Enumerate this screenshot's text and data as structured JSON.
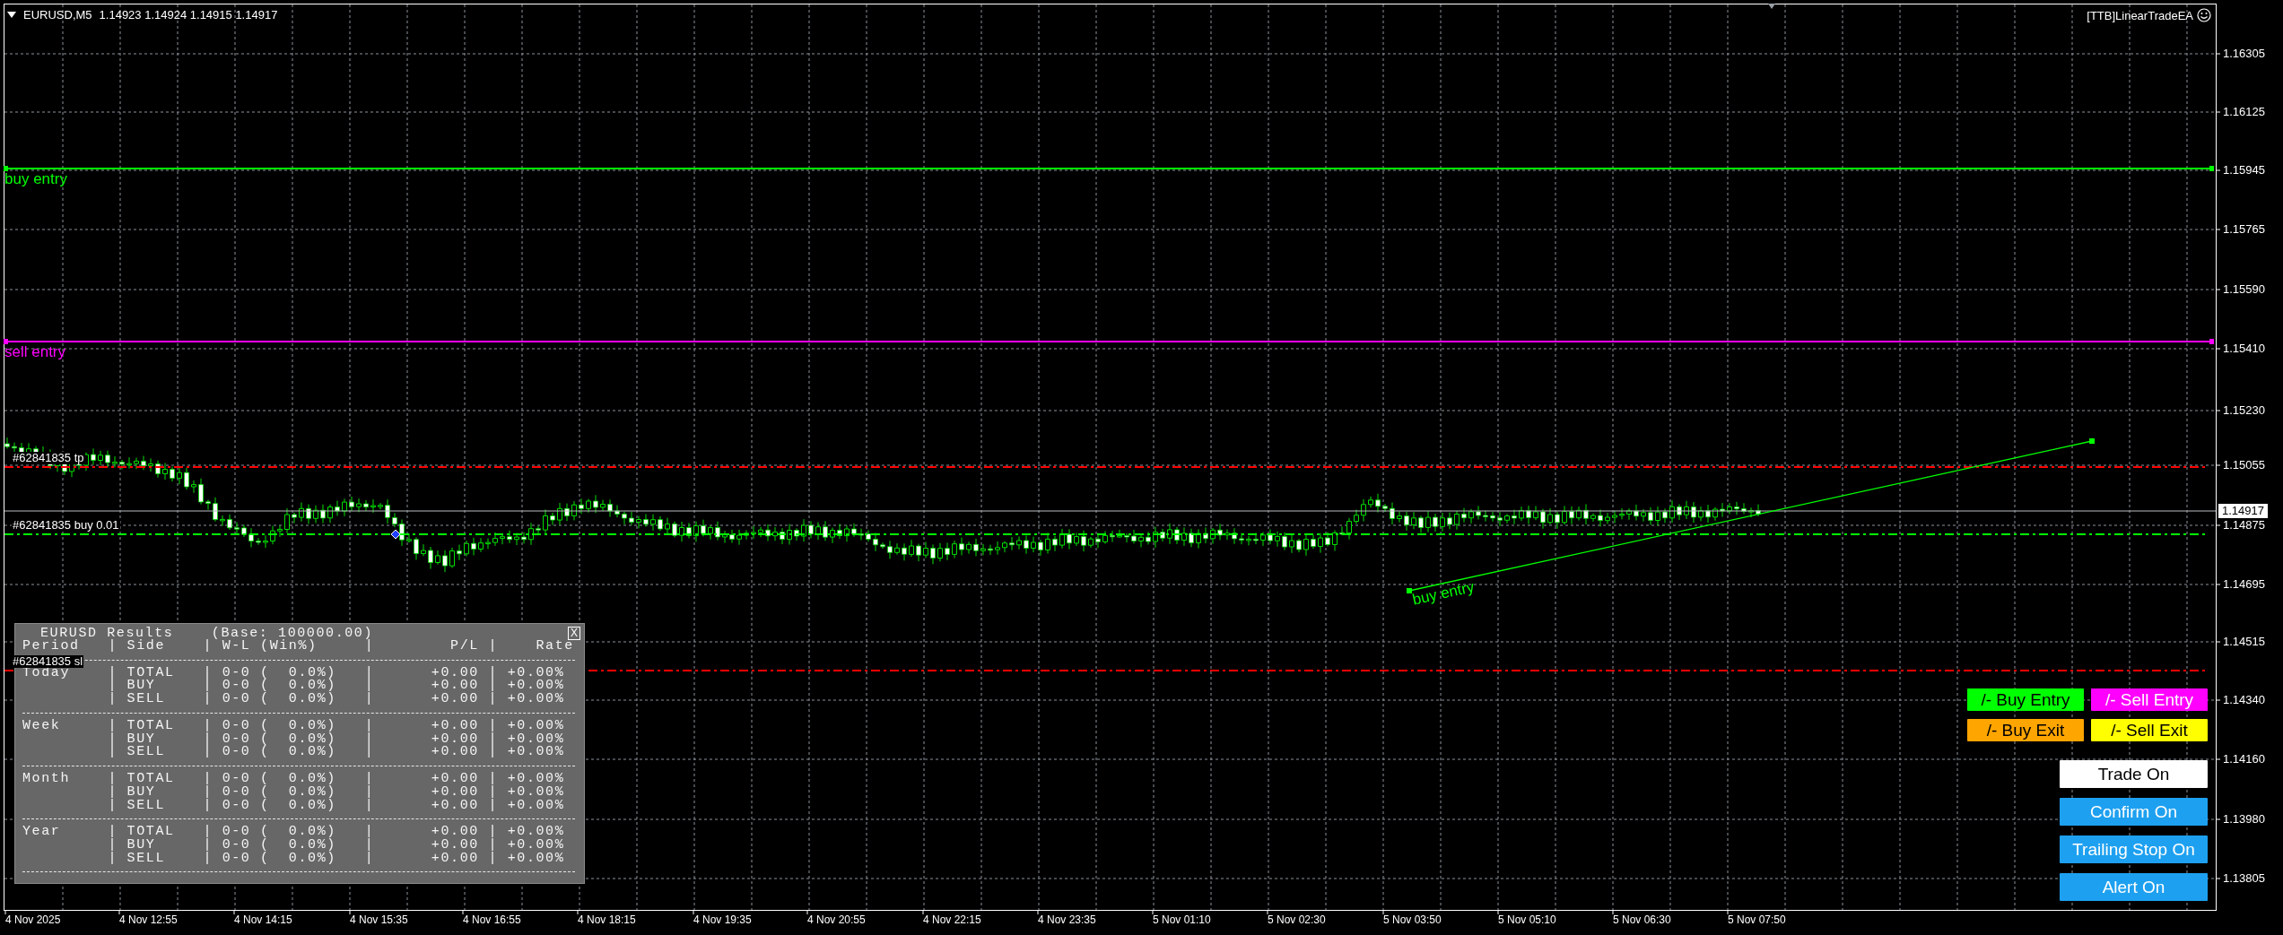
{
  "chart_header": {
    "symbol": "EURUSD,M5",
    "prices": "1.14923 1.14924 1.14915 1.14917"
  },
  "expert_label": "[TTB]LinearTradeEA",
  "price_axis": {
    "labels": [
      "1.16305",
      "1.16125",
      "1.15945",
      "1.15765",
      "1.15590",
      "1.15410",
      "1.15230",
      "1.15055",
      "1.14875",
      "1.14695",
      "1.14515",
      "1.14340",
      "1.14160",
      "1.13980",
      "1.13805"
    ],
    "current_price": "1.14917"
  },
  "time_axis": {
    "labels": [
      "4 Nov 2025",
      "4 Nov 12:55",
      "4 Nov 14:15",
      "4 Nov 15:35",
      "4 Nov 16:55",
      "4 Nov 18:15",
      "4 Nov 19:35",
      "4 Nov 20:55",
      "4 Nov 22:15",
      "4 Nov 23:35",
      "5 Nov 01:10",
      "5 Nov 02:30",
      "5 Nov 03:50",
      "5 Nov 05:10",
      "5 Nov 06:30",
      "5 Nov 07:50"
    ]
  },
  "chart_lines": [
    {
      "kind": "level",
      "label": "buy entry",
      "color": "#00ff00"
    },
    {
      "kind": "level",
      "label": "sell entry",
      "color": "#ff00ff"
    },
    {
      "kind": "order",
      "label": "#62841835 tp",
      "color": "#ff0000"
    },
    {
      "kind": "order",
      "label": "#62841835 buy 0.01",
      "color": "#00ff00"
    },
    {
      "kind": "order",
      "label": "#62841835 sl",
      "color": "#ff0000"
    },
    {
      "kind": "trend",
      "label": "buy entry",
      "color": "#00ff00"
    }
  ],
  "results_panel": {
    "title": "EURUSD Results    (Base: 100000.00)",
    "close": "X",
    "header": "Period   | Side    | W-L (Win%)     |        P/L |    Rate",
    "groups": [
      {
        "lines": [
          "Today    | TOTAL   | 0-0 (  0.0%)   |      +0.00 | +0.00%",
          "         | BUY     | 0-0 (  0.0%)   |      +0.00 | +0.00%",
          "         | SELL    | 0-0 (  0.0%)   |      +0.00 | +0.00%"
        ]
      },
      {
        "lines": [
          "Week     | TOTAL   | 0-0 (  0.0%)   |      +0.00 | +0.00%",
          "         | BUY     | 0-0 (  0.0%)   |      +0.00 | +0.00%",
          "         | SELL    | 0-0 (  0.0%)   |      +0.00 | +0.00%"
        ]
      },
      {
        "lines": [
          "Month    | TOTAL   | 0-0 (  0.0%)   |      +0.00 | +0.00%",
          "         | BUY     | 0-0 (  0.0%)   |      +0.00 | +0.00%",
          "         | SELL    | 0-0 (  0.0%)   |      +0.00 | +0.00%"
        ]
      },
      {
        "lines": [
          "Year     | TOTAL   | 0-0 (  0.0%)   |      +0.00 | +0.00%",
          "         | BUY     | 0-0 (  0.0%)   |      +0.00 | +0.00%",
          "         | SELL    | 0-0 (  0.0%)   |      +0.00 | +0.00%"
        ]
      }
    ]
  },
  "entry_buttons": [
    {
      "label": "/- Buy Entry",
      "color": "#00ff00"
    },
    {
      "label": "/- Sell Entry",
      "color": "#ff00ff"
    },
    {
      "label": "/- Buy Exit",
      "color": "#ffa500"
    },
    {
      "label": "/- Sell Exit",
      "color": "#ffff00"
    }
  ],
  "toggle_buttons": [
    {
      "label": "Trade On",
      "color": "#ffffff"
    },
    {
      "label": "Confirm On",
      "color": "#1ea0f0"
    },
    {
      "label": "Trailing Stop On",
      "color": "#1ea0f0"
    },
    {
      "label": "Alert On",
      "color": "#1ea0f0"
    }
  ]
}
